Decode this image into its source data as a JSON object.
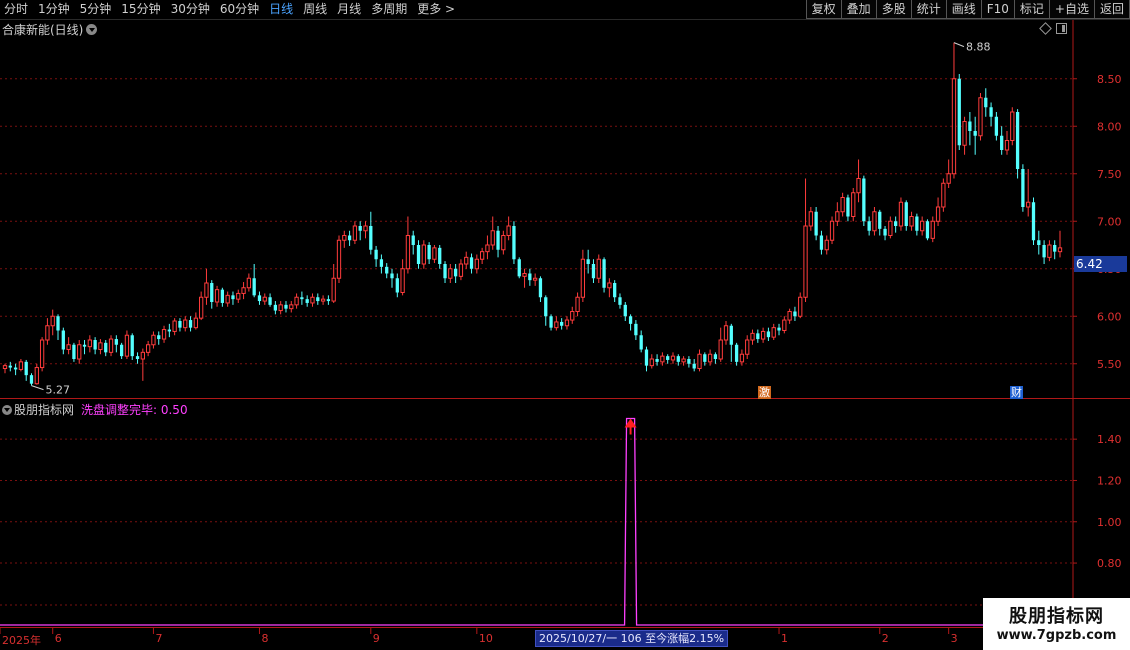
{
  "toolbar": {
    "periods": [
      "分时",
      "1分钟",
      "5分钟",
      "15分钟",
      "30分钟",
      "60分钟",
      "日线",
      "周线",
      "月线",
      "多周期",
      "更多 >"
    ],
    "active_period": "日线",
    "actions": [
      "复权",
      "叠加",
      "多股",
      "统计",
      "画线",
      "F10",
      "标记",
      "+自选",
      "返回"
    ]
  },
  "stock": {
    "title": "合康新能(日线)",
    "high_label": "8.88",
    "low_label": "5.27",
    "last_price": "6.42",
    "tag_ji": "激",
    "tag_cai": "财"
  },
  "indicator": {
    "title": "股朋指标网",
    "value_text": "洗盘调整完毕: 0.50"
  },
  "axes": {
    "price_ticks": [
      "8.50",
      "8.00",
      "7.50",
      "7.00",
      "6.50",
      "6.00",
      "5.50"
    ],
    "ind_ticks": [
      "1.40",
      "1.20",
      "1.00",
      "0.80"
    ],
    "x_labels": [
      "2025年",
      "6",
      "7",
      "8",
      "9",
      "10",
      "1",
      "2",
      "3"
    ]
  },
  "date_box": "2025/10/27/一 106 至今涨幅2.15%",
  "watermark": {
    "title": "股朋指标网",
    "url": "www.7gpzb.com"
  },
  "colors": {
    "up": "#ff3c3c",
    "down": "#54ffff",
    "indicator": "#ff40ff",
    "grid": "#7a1010",
    "axis": "#b01818"
  },
  "chart_data": {
    "type": "candlestick",
    "candles": [
      [
        5.45,
        5.48,
        5.4,
        5.5
      ],
      [
        5.48,
        5.46,
        5.42,
        5.52
      ],
      [
        5.46,
        5.44,
        5.38,
        5.5
      ],
      [
        5.44,
        5.52,
        5.42,
        5.55
      ],
      [
        5.52,
        5.38,
        5.32,
        5.54
      ],
      [
        5.38,
        5.29,
        5.27,
        5.4
      ],
      [
        5.29,
        5.46,
        5.28,
        5.5
      ],
      [
        5.46,
        5.75,
        5.42,
        5.78
      ],
      [
        5.75,
        5.9,
        5.7,
        5.98
      ],
      [
        5.9,
        6.0,
        5.8,
        6.07
      ],
      [
        6.0,
        5.85,
        5.75,
        6.02
      ],
      [
        5.85,
        5.65,
        5.6,
        5.88
      ],
      [
        5.65,
        5.7,
        5.6,
        5.78
      ],
      [
        5.7,
        5.55,
        5.52,
        5.72
      ],
      [
        5.55,
        5.7,
        5.5,
        5.75
      ],
      [
        5.7,
        5.68,
        5.6,
        5.75
      ],
      [
        5.68,
        5.75,
        5.62,
        5.8
      ],
      [
        5.75,
        5.65,
        5.6,
        5.78
      ],
      [
        5.65,
        5.72,
        5.6,
        5.76
      ],
      [
        5.72,
        5.62,
        5.58,
        5.75
      ],
      [
        5.62,
        5.76,
        5.58,
        5.8
      ],
      [
        5.76,
        5.7,
        5.62,
        5.8
      ],
      [
        5.7,
        5.58,
        5.55,
        5.72
      ],
      [
        5.58,
        5.8,
        5.55,
        5.85
      ],
      [
        5.8,
        5.58,
        5.54,
        5.82
      ],
      [
        5.58,
        5.55,
        5.5,
        5.62
      ],
      [
        5.55,
        5.62,
        5.32,
        5.66
      ],
      [
        5.62,
        5.7,
        5.58,
        5.74
      ],
      [
        5.7,
        5.8,
        5.66,
        5.84
      ],
      [
        5.8,
        5.76,
        5.7,
        5.84
      ],
      [
        5.76,
        5.86,
        5.72,
        5.9
      ],
      [
        5.86,
        5.84,
        5.78,
        5.92
      ],
      [
        5.84,
        5.95,
        5.8,
        5.98
      ],
      [
        5.95,
        5.88,
        5.84,
        5.98
      ],
      [
        5.88,
        5.96,
        5.84,
        6.0
      ],
      [
        5.96,
        5.88,
        5.84,
        6.0
      ],
      [
        5.88,
        5.98,
        5.86,
        6.04
      ],
      [
        5.98,
        6.2,
        5.96,
        6.26
      ],
      [
        6.2,
        6.35,
        6.12,
        6.5
      ],
      [
        6.35,
        6.15,
        6.08,
        6.38
      ],
      [
        6.15,
        6.28,
        6.1,
        6.32
      ],
      [
        6.28,
        6.14,
        6.1,
        6.3
      ],
      [
        6.14,
        6.22,
        6.1,
        6.26
      ],
      [
        6.22,
        6.18,
        6.12,
        6.26
      ],
      [
        6.18,
        6.24,
        6.14,
        6.28
      ],
      [
        6.24,
        6.3,
        6.18,
        6.36
      ],
      [
        6.3,
        6.4,
        6.26,
        6.45
      ],
      [
        6.4,
        6.22,
        6.2,
        6.55
      ],
      [
        6.22,
        6.16,
        6.12,
        6.26
      ],
      [
        6.16,
        6.2,
        6.12,
        6.24
      ],
      [
        6.2,
        6.12,
        6.1,
        6.24
      ],
      [
        6.12,
        6.06,
        6.02,
        6.16
      ],
      [
        6.06,
        6.12,
        6.02,
        6.16
      ],
      [
        6.12,
        6.08,
        6.04,
        6.16
      ],
      [
        6.08,
        6.12,
        6.04,
        6.16
      ],
      [
        6.12,
        6.2,
        6.08,
        6.24
      ],
      [
        6.2,
        6.18,
        6.12,
        6.26
      ],
      [
        6.18,
        6.14,
        6.1,
        6.22
      ],
      [
        6.14,
        6.2,
        6.1,
        6.24
      ],
      [
        6.2,
        6.16,
        6.12,
        6.24
      ],
      [
        6.16,
        6.18,
        6.12,
        6.22
      ],
      [
        6.18,
        6.16,
        6.12,
        6.22
      ],
      [
        6.16,
        6.4,
        6.14,
        6.55
      ],
      [
        6.4,
        6.8,
        6.35,
        6.85
      ],
      [
        6.8,
        6.85,
        6.72,
        6.9
      ],
      [
        6.85,
        6.8,
        6.74,
        6.9
      ],
      [
        6.8,
        6.95,
        6.76,
        7.0
      ],
      [
        6.95,
        6.9,
        6.8,
        7.0
      ],
      [
        6.9,
        6.95,
        6.82,
        7.0
      ],
      [
        6.95,
        6.7,
        6.65,
        7.1
      ],
      [
        6.7,
        6.6,
        6.52,
        6.74
      ],
      [
        6.6,
        6.52,
        6.45,
        6.65
      ],
      [
        6.52,
        6.45,
        6.4,
        6.56
      ],
      [
        6.45,
        6.4,
        6.3,
        6.5
      ],
      [
        6.4,
        6.25,
        6.2,
        6.45
      ],
      [
        6.25,
        6.5,
        6.22,
        6.6
      ],
      [
        6.5,
        6.85,
        6.45,
        7.05
      ],
      [
        6.85,
        6.75,
        6.65,
        6.9
      ],
      [
        6.75,
        6.55,
        6.5,
        6.8
      ],
      [
        6.55,
        6.75,
        6.5,
        6.8
      ],
      [
        6.75,
        6.6,
        6.55,
        6.78
      ],
      [
        6.6,
        6.72,
        6.56,
        6.75
      ],
      [
        6.72,
        6.55,
        6.5,
        6.75
      ],
      [
        6.55,
        6.4,
        6.35,
        6.58
      ],
      [
        6.4,
        6.5,
        6.35,
        6.55
      ],
      [
        6.5,
        6.42,
        6.35,
        6.55
      ],
      [
        6.42,
        6.55,
        6.38,
        6.6
      ],
      [
        6.55,
        6.62,
        6.5,
        6.68
      ],
      [
        6.62,
        6.5,
        6.45,
        6.66
      ],
      [
        6.5,
        6.6,
        6.45,
        6.65
      ],
      [
        6.6,
        6.68,
        6.55,
        6.72
      ],
      [
        6.68,
        6.75,
        6.6,
        6.85
      ],
      [
        6.75,
        6.9,
        6.7,
        7.05
      ],
      [
        6.9,
        6.7,
        6.62,
        6.95
      ],
      [
        6.7,
        6.85,
        6.65,
        6.9
      ],
      [
        6.85,
        6.95,
        6.8,
        7.05
      ],
      [
        6.95,
        6.6,
        6.55,
        7.0
      ],
      [
        6.6,
        6.42,
        6.4,
        6.62
      ],
      [
        6.42,
        6.45,
        6.3,
        6.5
      ],
      [
        6.45,
        6.38,
        6.32,
        6.5
      ],
      [
        6.38,
        6.4,
        6.32,
        6.45
      ],
      [
        6.4,
        6.2,
        6.15,
        6.42
      ],
      [
        6.2,
        6.0,
        5.9,
        6.22
      ],
      [
        6.0,
        5.88,
        5.85,
        6.02
      ],
      [
        5.88,
        5.94,
        5.85,
        6.0
      ],
      [
        5.94,
        5.9,
        5.86,
        5.98
      ],
      [
        5.9,
        5.96,
        5.86,
        6.0
      ],
      [
        5.96,
        6.05,
        5.92,
        6.1
      ],
      [
        6.05,
        6.2,
        6.0,
        6.25
      ],
      [
        6.2,
        6.6,
        6.15,
        6.7
      ],
      [
        6.6,
        6.55,
        6.45,
        6.7
      ],
      [
        6.55,
        6.4,
        6.35,
        6.6
      ],
      [
        6.4,
        6.6,
        6.35,
        6.65
      ],
      [
        6.6,
        6.3,
        6.25,
        6.62
      ],
      [
        6.3,
        6.35,
        6.2,
        6.4
      ],
      [
        6.35,
        6.2,
        6.15,
        6.38
      ],
      [
        6.2,
        6.12,
        6.08,
        6.24
      ],
      [
        6.12,
        6.0,
        5.95,
        6.15
      ],
      [
        6.0,
        5.92,
        5.85,
        6.02
      ],
      [
        5.92,
        5.8,
        5.75,
        5.96
      ],
      [
        5.8,
        5.65,
        5.62,
        5.85
      ],
      [
        5.65,
        5.48,
        5.42,
        5.68
      ],
      [
        5.48,
        5.55,
        5.45,
        5.6
      ],
      [
        5.55,
        5.52,
        5.48,
        5.6
      ],
      [
        5.52,
        5.58,
        5.48,
        5.62
      ],
      [
        5.58,
        5.54,
        5.5,
        5.6
      ],
      [
        5.54,
        5.58,
        5.5,
        5.62
      ],
      [
        5.58,
        5.52,
        5.48,
        5.6
      ],
      [
        5.52,
        5.55,
        5.48,
        5.58
      ],
      [
        5.55,
        5.5,
        5.46,
        5.58
      ],
      [
        5.5,
        5.45,
        5.42,
        5.55
      ],
      [
        5.45,
        5.6,
        5.42,
        5.65
      ],
      [
        5.6,
        5.52,
        5.48,
        5.62
      ],
      [
        5.52,
        5.6,
        5.48,
        5.65
      ],
      [
        5.6,
        5.55,
        5.5,
        5.62
      ],
      [
        5.55,
        5.75,
        5.52,
        5.88
      ],
      [
        5.75,
        5.9,
        5.7,
        5.95
      ],
      [
        5.9,
        5.7,
        5.52,
        5.92
      ],
      [
        5.7,
        5.52,
        5.48,
        5.72
      ],
      [
        5.52,
        5.6,
        5.48,
        5.65
      ],
      [
        5.6,
        5.75,
        5.55,
        5.8
      ],
      [
        5.75,
        5.82,
        5.7,
        5.86
      ],
      [
        5.82,
        5.76,
        5.72,
        5.86
      ],
      [
        5.76,
        5.84,
        5.72,
        5.88
      ],
      [
        5.84,
        5.78,
        5.74,
        5.88
      ],
      [
        5.78,
        5.88,
        5.75,
        5.92
      ],
      [
        5.88,
        5.85,
        5.8,
        5.92
      ],
      [
        5.85,
        5.96,
        5.82,
        6.0
      ],
      [
        5.96,
        6.05,
        5.92,
        6.08
      ],
      [
        6.05,
        6.0,
        5.95,
        6.1
      ],
      [
        6.0,
        6.2,
        5.98,
        6.25
      ],
      [
        6.2,
        6.95,
        6.15,
        7.45
      ],
      [
        6.95,
        7.1,
        6.9,
        7.15
      ],
      [
        7.1,
        6.85,
        6.8,
        7.15
      ],
      [
        6.85,
        6.7,
        6.65,
        6.9
      ],
      [
        6.7,
        6.8,
        6.65,
        6.85
      ],
      [
        6.8,
        7.0,
        6.76,
        7.05
      ],
      [
        7.0,
        7.1,
        6.95,
        7.2
      ],
      [
        7.1,
        7.25,
        7.05,
        7.3
      ],
      [
        7.25,
        7.05,
        7.0,
        7.28
      ],
      [
        7.05,
        7.3,
        7.0,
        7.35
      ],
      [
        7.3,
        7.45,
        7.2,
        7.65
      ],
      [
        7.45,
        7.0,
        6.95,
        7.48
      ],
      [
        7.0,
        6.9,
        6.85,
        7.05
      ],
      [
        6.9,
        7.1,
        6.85,
        7.15
      ],
      [
        7.1,
        6.92,
        6.85,
        7.12
      ],
      [
        6.92,
        6.85,
        6.8,
        6.95
      ],
      [
        6.85,
        7.0,
        6.82,
        7.05
      ],
      [
        7.0,
        6.95,
        6.88,
        7.05
      ],
      [
        6.95,
        7.2,
        6.9,
        7.25
      ],
      [
        7.2,
        6.95,
        6.9,
        7.22
      ],
      [
        6.95,
        7.05,
        6.9,
        7.1
      ],
      [
        7.05,
        6.9,
        6.85,
        7.08
      ],
      [
        6.9,
        7.0,
        6.85,
        7.05
      ],
      [
        7.0,
        6.82,
        6.8,
        7.02
      ],
      [
        6.82,
        7.0,
        6.78,
        7.05
      ],
      [
        7.0,
        7.15,
        6.95,
        7.25
      ],
      [
        7.15,
        7.4,
        7.1,
        7.45
      ],
      [
        7.4,
        7.5,
        7.35,
        7.65
      ],
      [
        7.5,
        8.5,
        7.45,
        8.88
      ],
      [
        8.5,
        7.8,
        7.75,
        8.55
      ],
      [
        7.8,
        8.05,
        7.7,
        8.1
      ],
      [
        8.05,
        7.95,
        7.8,
        8.15
      ],
      [
        7.95,
        7.9,
        7.7,
        8.1
      ],
      [
        7.9,
        8.3,
        7.85,
        8.35
      ],
      [
        8.3,
        8.2,
        8.1,
        8.4
      ],
      [
        8.2,
        8.1,
        8.0,
        8.25
      ],
      [
        8.1,
        7.9,
        7.85,
        8.15
      ],
      [
        7.9,
        7.75,
        7.7,
        8.0
      ],
      [
        7.75,
        7.85,
        7.7,
        7.95
      ],
      [
        7.85,
        8.15,
        7.8,
        8.2
      ],
      [
        8.15,
        7.55,
        7.45,
        8.18
      ],
      [
        7.55,
        7.15,
        7.1,
        7.6
      ],
      [
        7.15,
        7.2,
        7.05,
        7.55
      ],
      [
        7.2,
        6.8,
        6.75,
        7.25
      ],
      [
        6.8,
        6.75,
        6.65,
        6.9
      ],
      [
        6.75,
        6.62,
        6.55,
        6.8
      ],
      [
        6.62,
        6.75,
        6.58,
        6.8
      ],
      [
        6.75,
        6.68,
        6.6,
        6.8
      ],
      [
        6.68,
        6.72,
        6.62,
        6.9
      ]
    ],
    "price_range": [
      5.15,
      8.95
    ],
    "indicator": {
      "name": "洗盘调整完毕",
      "baseline": 0.5,
      "spike_index": 118,
      "spike_value": 1.5,
      "range": [
        0.5,
        1.58
      ]
    },
    "month_markers": [
      {
        "label": "2025年",
        "index": 0
      },
      {
        "label": "6",
        "index": 9
      },
      {
        "label": "7",
        "index": 28
      },
      {
        "label": "8",
        "index": 48
      },
      {
        "label": "9",
        "index": 69
      },
      {
        "label": "10",
        "index": 89
      },
      {
        "label": "1",
        "index": 146
      },
      {
        "label": "2",
        "index": 165
      },
      {
        "label": "3",
        "index": 178
      }
    ]
  }
}
